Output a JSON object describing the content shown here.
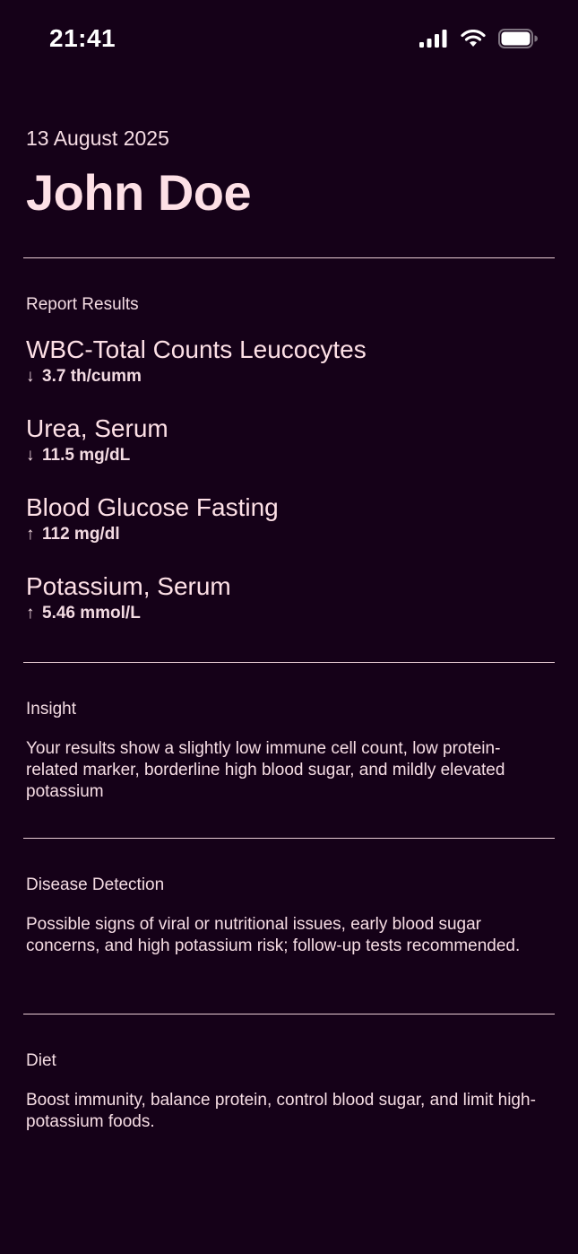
{
  "status_bar": {
    "time": "21:41",
    "icons": [
      "cellular-signal-icon",
      "wifi-icon",
      "battery-icon"
    ]
  },
  "header": {
    "date": "13 August 2025",
    "patient_name": "John Doe"
  },
  "report": {
    "label": "Report Results",
    "results": [
      {
        "name": "WBC-Total Counts Leucocytes",
        "direction": "down",
        "arrow": "↓",
        "value": "3.7 th/cumm"
      },
      {
        "name": "Urea, Serum",
        "direction": "down",
        "arrow": "↓",
        "value": "11.5 mg/dL"
      },
      {
        "name": "Blood Glucose Fasting",
        "direction": "up",
        "arrow": "↑",
        "value": "112 mg/dl"
      },
      {
        "name": "Potassium, Serum",
        "direction": "up",
        "arrow": "↑",
        "value": "5.46 mmol/L"
      }
    ]
  },
  "insight": {
    "label": "Insight",
    "text": "Your results show a slightly low immune cell count, low protein-related marker, borderline high blood sugar, and mildly elevated potassium"
  },
  "disease_detection": {
    "label": "Disease Detection",
    "text": "Possible signs of viral or nutritional issues, early blood sugar concerns, and high potassium risk; follow-up tests recommended."
  },
  "diet": {
    "label": "Diet",
    "text": "Boost immunity, balance protein, control blood sugar, and limit high-potassium foods."
  },
  "colors": {
    "background": "#150118",
    "text_primary": "#fde0e6",
    "divider": "#e8cdd4"
  }
}
